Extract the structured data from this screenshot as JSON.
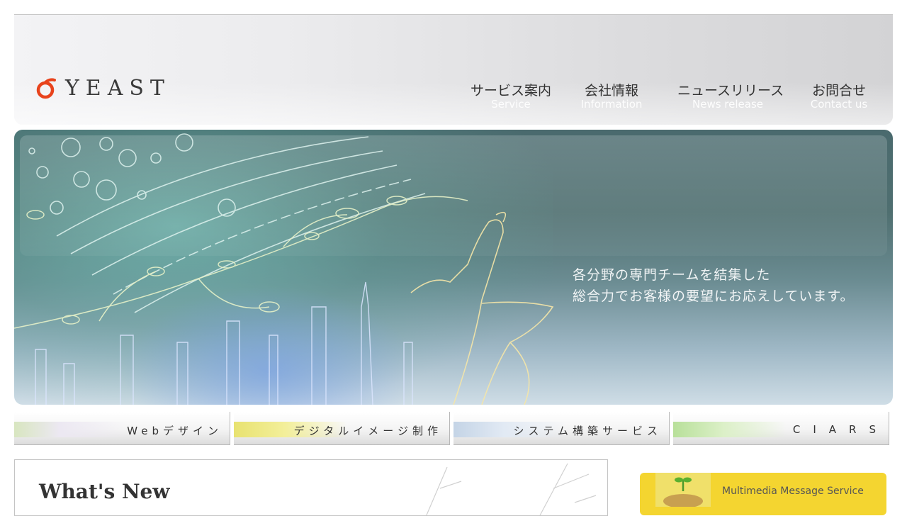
{
  "header": {
    "logo_text": "YEAST",
    "nav": [
      {
        "jp": "サービス案内",
        "en": "Service"
      },
      {
        "jp": "会社情報",
        "en": "Information"
      },
      {
        "jp": "ニュースリリース",
        "en": "News release"
      },
      {
        "jp": "お問合せ",
        "en": "Contact us"
      }
    ]
  },
  "hero": {
    "line1": "各分野の専門チームを結集した",
    "line2": "総合力でお客様の要望にお応えしています。"
  },
  "services": [
    {
      "label": "Webデザイン"
    },
    {
      "label": "デジタルイメージ制作"
    },
    {
      "label": "システム構築サービス"
    },
    {
      "label": "CIARS"
    }
  ],
  "news": {
    "title": "What's New"
  },
  "banner": {
    "text": "Multimedia Message Service"
  },
  "colors": {
    "logo_accent": "#e8431c",
    "banner_yellow": "#f4d530"
  }
}
